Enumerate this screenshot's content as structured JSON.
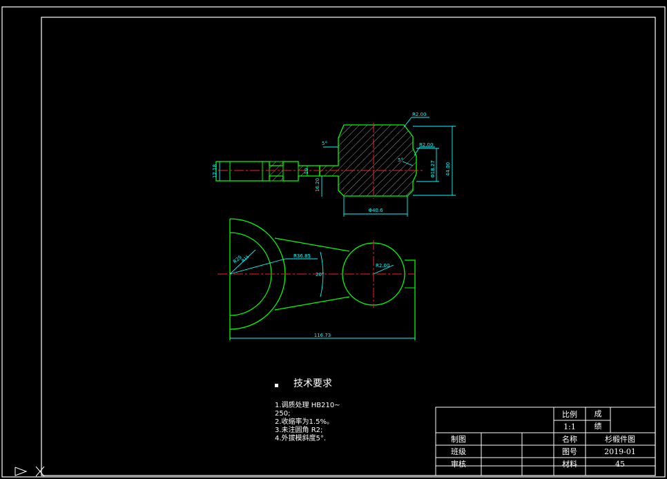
{
  "colors": {
    "background": "#000000",
    "frame": "#ffffff",
    "part_outline": "#00ff00",
    "dimension": "#00ffff",
    "centerline": "#ff2020",
    "hatch": "#a0a0a0"
  },
  "dimensions": {
    "r2_top": "R2.00",
    "r2_mid": "R2.00",
    "r2_circle": "R2.00",
    "angle_left": "5°",
    "angle_right": "5°",
    "dia_neck": "Φ18.27",
    "height_44": "44.00",
    "width_40": "Φ40.6",
    "left_height": "12.18",
    "neck_16": "16.20",
    "neck_small": "10",
    "radius_r36": "R36.85",
    "angle_20": "20°",
    "overall_length": "116.73",
    "left_arc_r": "R25",
    "left_arc_r2": "R15"
  },
  "tech_requirements": {
    "title": "技术要求",
    "lines": [
      "1.调质处理 HB210~",
      "250;",
      "2.收缩率为1.5%。",
      "3.未注圆角 R2;",
      "4.外拔模斜度5°."
    ]
  },
  "title_block": {
    "scale_label": "比例",
    "scale_value": "1:1",
    "grade_label": "成",
    "grade_label2": "绩",
    "drawn_label": "制图",
    "class_label": "班级",
    "check_label": "审核",
    "name_label": "名称",
    "name_value": "杉椴件图",
    "number_label": "图号",
    "number_value": "2019-01",
    "material_label": "材料",
    "material_value": "45"
  }
}
